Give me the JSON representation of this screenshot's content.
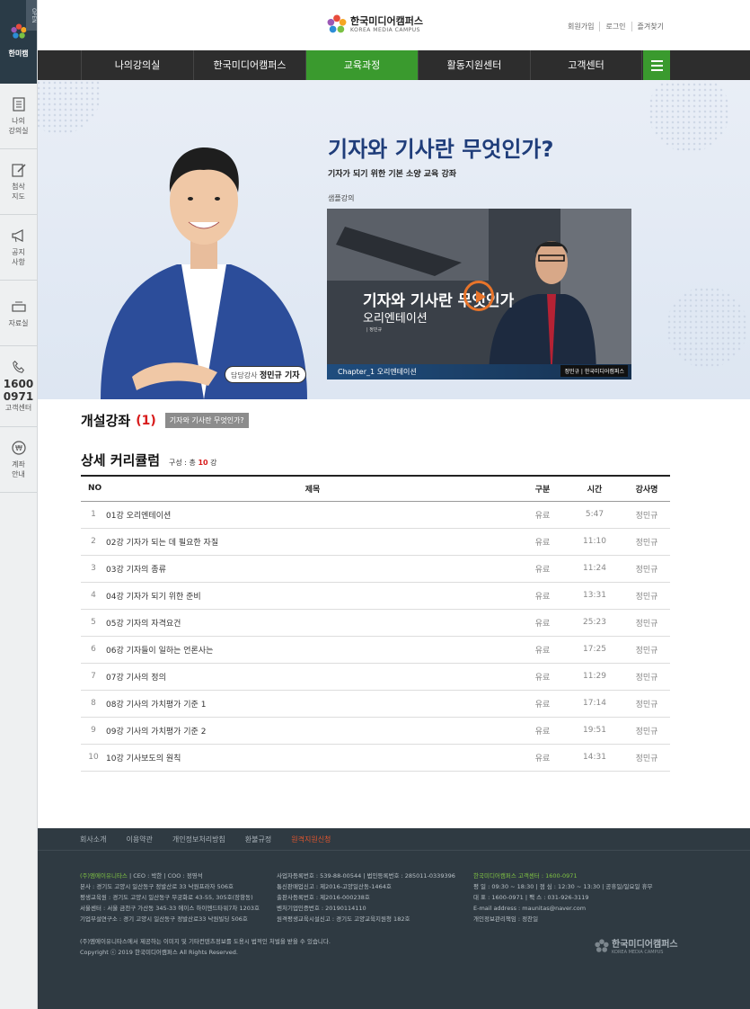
{
  "sidebar": {
    "open_label": "OPEN",
    "brand": "한미캠",
    "items": [
      {
        "label": "나의\n강의실",
        "icon": "book-icon"
      },
      {
        "label": "첨삭\n지도",
        "icon": "edit-icon"
      },
      {
        "label": "공지\n사항",
        "icon": "megaphone-icon"
      },
      {
        "label": "자료실",
        "icon": "tray-icon"
      },
      {
        "num1": "1600",
        "num2": "0971",
        "label": "고객센터",
        "icon": "phone-icon"
      },
      {
        "label": "계좌\n안내",
        "icon": "bank-icon"
      }
    ]
  },
  "header": {
    "brand_title": "한국미디어캠퍼스",
    "brand_sub": "KOREA MEDIA CAMPUS",
    "util": [
      "회원가입",
      "로그인",
      "즐겨찾기"
    ]
  },
  "nav": {
    "items": [
      "나의강의실",
      "한국미디어캠퍼스",
      "교육과정",
      "활동지원센터",
      "고객센터"
    ],
    "active": 2
  },
  "hero": {
    "title": "기자와 기사란 무엇인가?",
    "subtitle": "기자가 되기 위한 기본 소양 교육 강좌",
    "sample_label": "샘플강의",
    "instructor_prefix": "담당강사",
    "instructor_name": "정민규 기자",
    "video": {
      "title1": "기자와 기사란 무엇인가",
      "title2": "오리엔테이션",
      "title3": "| 정민규",
      "chapter": "Chapter_1  오리엔테이션",
      "credit": "정민규 | 한국미디어캠퍼스"
    }
  },
  "open_course": {
    "title": "개설강좌",
    "count": "(1)",
    "tag": "기자와 기사란 무엇인가?"
  },
  "curriculum": {
    "title": "상세 커리큘럼",
    "info_prefix": "구성 : 총",
    "info_count": "10",
    "info_suffix": "강",
    "headers": [
      "NO",
      "제목",
      "구분",
      "시간",
      "강사명"
    ],
    "rows": [
      {
        "no": "1",
        "title": "01강 오리엔테이션",
        "type": "유료",
        "time": "5:47",
        "teacher": "정민규"
      },
      {
        "no": "2",
        "title": "02강 기자가 되는 데 필요한 자질",
        "type": "유료",
        "time": "11:10",
        "teacher": "정민규"
      },
      {
        "no": "3",
        "title": "03강 기자의 종류",
        "type": "유료",
        "time": "11:24",
        "teacher": "정민규"
      },
      {
        "no": "4",
        "title": "04강 기자가 되기 위한 준비",
        "type": "유료",
        "time": "13:31",
        "teacher": "정민규"
      },
      {
        "no": "5",
        "title": "05강 기자의 자격요건",
        "type": "유료",
        "time": "25:23",
        "teacher": "정민규"
      },
      {
        "no": "6",
        "title": "06강 기자들이 일하는 언론사는",
        "type": "유료",
        "time": "17:25",
        "teacher": "정민규"
      },
      {
        "no": "7",
        "title": "07강 기사의 정의",
        "type": "유료",
        "time": "11:29",
        "teacher": "정민규"
      },
      {
        "no": "8",
        "title": "08강 기사의 가치평가 기준 1",
        "type": "유료",
        "time": "17:14",
        "teacher": "정민규"
      },
      {
        "no": "9",
        "title": "09강 기사의 가치평가 기준 2",
        "type": "유료",
        "time": "19:51",
        "teacher": "정민규"
      },
      {
        "no": "10",
        "title": "10강 기사보도의 원칙",
        "type": "유료",
        "time": "14:31",
        "teacher": "정민규"
      }
    ]
  },
  "footer": {
    "links": [
      "회사소개",
      "이용약관",
      "개인정보처리방침",
      "환불규정",
      "원격지원신청"
    ],
    "col1": [
      "(주)엠에이유니타스 | CEO : 박한 | COO : 정영석",
      "본사 : 경기도 고양시 일산동구 정발산로 33 낙원프라자 506호",
      "평생교육원 : 경기도 고양시 일산동구 무궁화로 43-55, 305호(장항동)",
      "서울센터 : 서울 금천구 가산동 345-33 에이스 하이엔드타워7차 1203호",
      "기업부설연구소 : 경기 고양시 일산동구 정발산로33 낙원빌딩 506호"
    ],
    "col2": [
      "사업자등록번호 : 539-88-00544 | 법인등록번호 : 285011-0339396",
      "통신판매업신고 : 제2016-고양일산동-1464호",
      "출판사등록번호 : 제2016-000238호",
      "벤처기업인증번호 : 20190114110",
      "원격평생교육시설신고 : 경기도 고양교육지원청 182호"
    ],
    "col3": [
      "한국미디어캠퍼스 고객센터 : 1600-0971",
      "평 일 : 09:30 ~ 18:30 | 점 심 : 12:30 ~ 13:30 | 공휴일/일요일 휴무",
      "대 표 : 1600-0971 | 팩 스 : 031-926-3119",
      "E-mail address : maunitas@naver.com",
      "개인정보관리책임 : 정찬일"
    ],
    "copy1": "(주)엠에이유니타스에서 제공하는 이미지 및 기타컨텐츠정보를 도용시 법적인 처벌을 받을 수 있습니다.",
    "copy2": "Copyright ⓒ 2019 한국미디어캠퍼스 All Rights Reserved.",
    "logo_title": "한국미디어캠퍼스",
    "logo_sub": "KOREA MEDIA CAMPUS"
  }
}
